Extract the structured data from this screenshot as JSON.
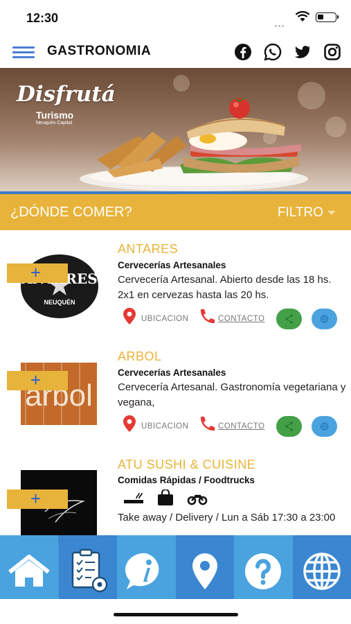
{
  "status_bar": {
    "time": "12:30",
    "battery_level": 0.35
  },
  "header": {
    "title": "GASTRONOMIA",
    "social_icons": [
      "facebook-icon",
      "whatsapp-icon",
      "twitter-icon",
      "instagram-icon"
    ]
  },
  "banner": {
    "brand_script": "Disfrutá",
    "brand_name": "Turismo",
    "brand_city": "Neuquén Capital"
  },
  "section": {
    "title": "¿DÓNDE COMER?",
    "filter_label": "FILTRO"
  },
  "items": [
    {
      "name": "ANTARES",
      "category": "Cervecerías Artesanales",
      "description": "Cervecería Artesanal. Abierto desde las 18 hs. 2x1 en cervezas hasta las 20 hs.",
      "logo_text": "ANTARES",
      "logo_subtext": "NEUQUÉN",
      "add_label": "+",
      "location_label": "UBICACION",
      "contact_label": "CONTACTO"
    },
    {
      "name": "ARBOL",
      "category": "Cervecerías Artesanales",
      "description": "Cervecería Artesanal. Gastronomía vegetariana y vegana,",
      "logo_text": "árbol",
      "add_label": "+",
      "location_label": "UBICACION",
      "contact_label": "CONTACTO"
    },
    {
      "name": "ATU SUSHI & CUISINE",
      "category": "Comidas Rápidas / Foodtrucks",
      "description": "Take away / Delivery / Lun a Sáb 17:30 a 23:00",
      "add_label": "+",
      "amenities": [
        "no-smoking-icon",
        "takeaway-bag-icon",
        "delivery-motorbike-icon"
      ]
    }
  ],
  "bottom_nav": [
    "home-icon",
    "checklist-settings-icon",
    "info-chat-icon",
    "location-pin-icon",
    "help-icon",
    "globe-icon"
  ],
  "colors": {
    "accent": "#e8b33a",
    "nav_blue": "#4aa3df",
    "nav_dark": "#3b86d0",
    "share_green": "#43a047",
    "pin_red": "#e53935"
  }
}
